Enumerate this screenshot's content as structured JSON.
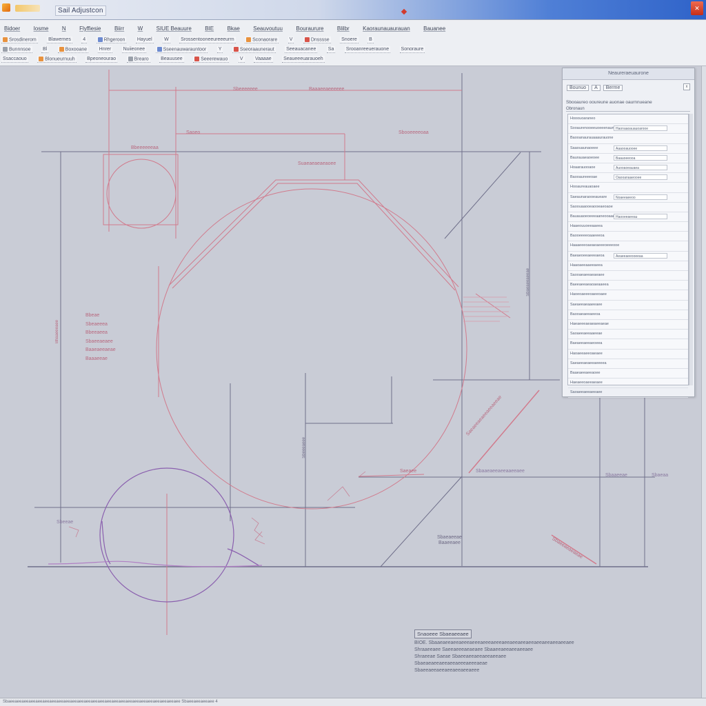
{
  "window": {
    "title": "Sail Adjustcon",
    "close_glyph": "✕"
  },
  "menu": [
    "Bidoer",
    "Iosme",
    "N",
    "Flyffiesie",
    "Biirr",
    "W",
    "SIUE Beauure",
    "BIE",
    "Bkae",
    "Seauvoutuu",
    "Bouraurure",
    "Blilbr",
    "Kaoraunauaurauan",
    "Bauanee"
  ],
  "toolbar_rows": [
    [
      "Srosdinerom",
      "Blawernes",
      "4",
      "Rhgeroon",
      "Hayuel",
      "W",
      "Srossentooneeureeeurrn",
      "Sconaorare",
      "V",
      "Dnsssse",
      "Snoere",
      "B"
    ],
    [
      "Bunnnsoe",
      "Bl",
      "Boxooane",
      "Hnrer",
      "Nuiieonee",
      "Sseenauwarauntoor",
      "Y",
      "Sseoraauneraut",
      "Seeauacanee",
      "Sa",
      "Srooanreeuerauone",
      "Sonoraure"
    ],
    [
      "Ssaccaouo",
      "Blonueurnuuh",
      "Bpeoneourao",
      "Brearo",
      "Beauusee",
      "Seeerewauo",
      "V",
      "Vaaaae",
      "Seaueeeuarauoeh"
    ]
  ],
  "panel": {
    "header": "Neaureraeuaurone",
    "tool_a": "Bounuo",
    "tool_b": "A",
    "tool_c": "Berme",
    "close_glyph": "x",
    "summary": "Sbooaureo ooureune auonae oaurnnueane",
    "section": "Obronaun",
    "rows": [
      {
        "label": "Hooouoaraneo",
        "value": ""
      },
      {
        "label": "Sooaurenooeeuoeeenaunaoee",
        "value": "Haonaaoauauoarooe"
      },
      {
        "label": "Baooanaurauaaaurauone",
        "value": ""
      },
      {
        "label": "Saaouaunaoeee",
        "value": "Aaaooauooee"
      },
      {
        "label": "Baurauaeaoeoee",
        "value": "Baauoeeooa"
      },
      {
        "label": "Hoaarauooaoe",
        "value": "Auooaoeauaea"
      },
      {
        "label": "Baooaureeeoae",
        "value": "Oaooanaaeooee"
      },
      {
        "label": "Hooaureauaoaee",
        "value": ""
      },
      {
        "label": "Saeaunaraooeaueare",
        "value": "Noaeeaeeoo"
      },
      {
        "label": "Saoouaaooeaooeaeoaoe",
        "value": ""
      },
      {
        "label": "Bauauaoeoeeeaaneooaae",
        "value": "Haooeeaeeau"
      },
      {
        "label": "Haaeouuoeeaaeea",
        "value": ""
      },
      {
        "label": "Baooeeeeoaaeeeoa",
        "value": ""
      },
      {
        "label": "Haaaeeeoaeaeaeeeoeeeooe",
        "value": ""
      },
      {
        "label": "Baeaeoeeaeeeaeoa",
        "value": "Aeaeeaeeooeeaa"
      },
      {
        "label": "Haaoaeeaaeeaeea",
        "value": ""
      },
      {
        "label": "Saooaeaeeaeaeaee",
        "value": ""
      },
      {
        "label": "Baeeaeeaeaoaeaaeea",
        "value": ""
      },
      {
        "label": "Haoeoaeeeoaeeoaee",
        "value": ""
      },
      {
        "label": "Saeaeeaeaaeeaee",
        "value": ""
      },
      {
        "label": "Baooaeaeeaeeoa",
        "value": ""
      },
      {
        "label": "Haeaeeeaeaeaeeaeae",
        "value": ""
      },
      {
        "label": "Saoaeeaeeaaeeae",
        "value": ""
      },
      {
        "label": "Baeaeeaeeaeoeea",
        "value": ""
      },
      {
        "label": "Haoaeeaeeoaeaee",
        "value": ""
      },
      {
        "label": "Saeaeeaeaeeaeeeea",
        "value": ""
      },
      {
        "label": "Baaeaeeaeeaoee",
        "value": ""
      },
      {
        "label": "Haeaeeoaeeaeaee",
        "value": ""
      },
      {
        "label": "Saoaeeaeeaeeaee",
        "value": ""
      }
    ]
  },
  "annotations": {
    "top_dim_a": "Sbeeeeeee",
    "top_dim_b": "Baaaeeaeeeeee",
    "upper_dim_a": "Saoeo",
    "upper_dim_b": "Sbooeeeeoaa",
    "left_box_label": "Bbeeeeeeaa",
    "mid_label": "Suaeaeaeaeaoee",
    "left_stack": [
      "Bbeae",
      "Sbeaeeea",
      "Bbeeaeea",
      "Sbaeeaeaee",
      "Baaeaeeaeae",
      "Baaaeeae"
    ],
    "left_vert": "Bhaaeeeaee",
    "right_vert": "Sbaeaeeaeeae",
    "center_vert": "Sbeeeaeee",
    "baseline_a": "Saeaee",
    "baseline_b": "Sbaaeaeeaeeaaeeaee",
    "baseline_c": "Sbaaeeae",
    "baseline_d": "Sbaeaa",
    "lower_a": "Sbeeae",
    "lower_b": "Sbaeaeeae",
    "lower_c": "Baaeeaee",
    "diag_label": "Saeaeeaeaeeaeeaeeae",
    "diag_label_b": "Sbaeeaeaeaeae"
  },
  "notes": {
    "title": "Snaoeee Sbaeaeeaee",
    "lines": [
      "BIOE. Sbaaeaeeaeeaeeeaeeeaeeeaeeeaeeaeeaeeaeeaeeaeeaeeaeeaee",
      "Shraaeeaee   Saeeaeeeaeaeaee   Sbaaeeaeeaeeaeeaee",
      "Shraeeae      Saeae   Sbaeeaeeaeeaeeaeeaee",
      "Sbaeaeaeeaeeaeeaeeeaeeeaeae",
      "Sbaeeaeeaeeaeeaeeaeeaeee"
    ]
  },
  "status": "Sbaeeaeeaeeaeeaeeaeeaeeaeeaeeaeeaeeaeeaeeaeeaeeaeeaeeaeeaeeaeeaeeaeeaeeaeeaee  Sbaeeaeeaeeaee  4",
  "colors": {
    "canvas": "#c9ccd6",
    "red_geometry": "#d17a8c",
    "purple_geometry": "#8a5fae",
    "dark_line": "#6f6f8a"
  }
}
